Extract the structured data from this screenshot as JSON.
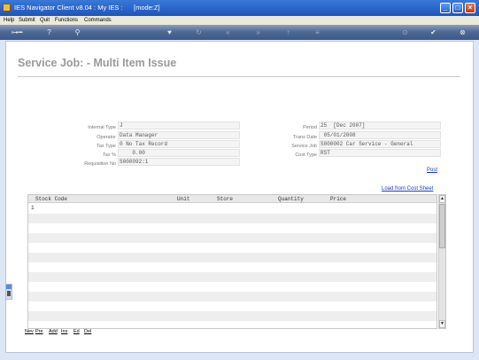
{
  "window": {
    "title": "IES Navigator Client v8.04 : My IES :      [mode:Z]"
  },
  "menu": {
    "items": [
      "Help",
      "Submit",
      "Quit",
      "Functions",
      "Commands"
    ]
  },
  "toolbar": {
    "icons": [
      "key-icon",
      "help-icon",
      "search-icon",
      "heart-icon",
      "refresh-icon",
      "rewind-icon",
      "fast-forward-icon",
      "up-arrow-icon",
      "list-icon",
      "lock-icon",
      "check-icon",
      "close-icon"
    ]
  },
  "page": {
    "title": "Service Job: - Multi Item Issue"
  },
  "form": {
    "left": {
      "internal_type_label": "Internal Type",
      "internal_type_value": "J",
      "operator_label": "Operator",
      "operator_value": "Data Manager",
      "tax_type_label": "Tax Type",
      "tax_type_value": "0 No Tax Record",
      "tax_pct_label": "Tax %",
      "tax_pct_value": "    0.00",
      "requisition_label": "Requisition No",
      "requisition_value": "S000092:1"
    },
    "right": {
      "period_label": "Period",
      "period_value": "25  [Dec 2007]",
      "trans_date_label": "Trans Date",
      "trans_date_value": " 05/01/2008",
      "service_job_label": "Service Job",
      "service_job_value": "S000002 Car Service - General",
      "cost_type_label": "Cost Type",
      "cost_type_value": "RST"
    }
  },
  "links": {
    "post": "Post",
    "load_cost_sheet": "Load from Cost Sheet"
  },
  "grid": {
    "columns": [
      "Stock Code",
      "Unit",
      "Store",
      "Quantity",
      "Price"
    ],
    "first_row_number": "1"
  },
  "nav": {
    "items": [
      "Nev",
      "Pre",
      "Add",
      "Ins",
      "Ed",
      "Del"
    ]
  },
  "colors": {
    "titlebar": "#1d55b8",
    "link": "#1a3cc8",
    "page_title": "#9a9a9a"
  }
}
